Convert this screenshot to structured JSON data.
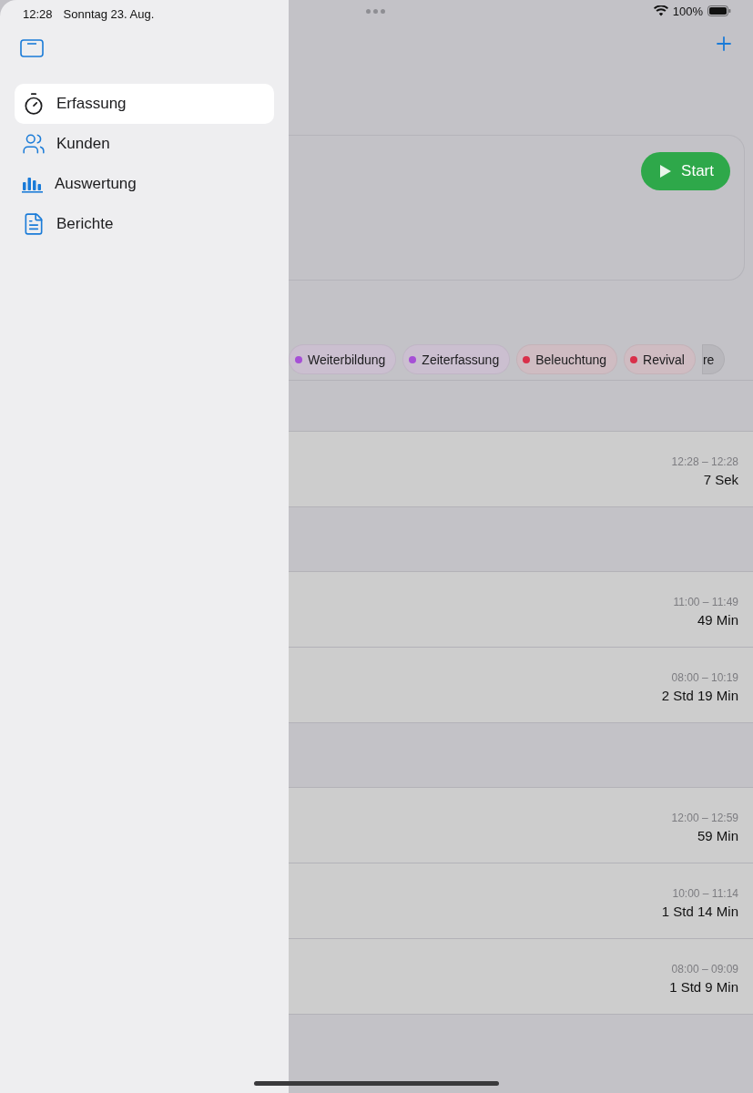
{
  "status_bar": {
    "time": "12:28",
    "date": "Sonntag 23. Aug.",
    "battery": "100%"
  },
  "sidebar": {
    "items": [
      {
        "label": "Erfassung",
        "selected": true
      },
      {
        "label": "Kunden",
        "selected": false
      },
      {
        "label": "Auswertung",
        "selected": false
      },
      {
        "label": "Berichte",
        "selected": false
      }
    ]
  },
  "main": {
    "start_button": "Start",
    "tags": [
      {
        "label": "Weiterbildung",
        "color": "#a64fd6"
      },
      {
        "label": "Zeiterfassung",
        "color": "#a64fd6"
      },
      {
        "label": "Beleuchtung",
        "color": "#d9304a"
      },
      {
        "label": "Revival",
        "color": "#d9304a"
      },
      {
        "label": "re"
      }
    ],
    "sections": [
      {
        "entries": [
          {
            "time_range": "12:28 – 12:28",
            "duration": "7 Sek"
          }
        ]
      },
      {
        "entries": [
          {
            "time_range": "11:00 – 11:49",
            "duration": "49 Min"
          },
          {
            "time_range": "08:00 – 10:19",
            "duration": "2 Std 19 Min"
          }
        ]
      },
      {
        "entries": [
          {
            "time_range": "12:00 – 12:59",
            "duration": "59 Min"
          },
          {
            "time_range": "10:00 – 11:14",
            "duration": "1 Std 14 Min"
          },
          {
            "time_range": "08:00 – 09:09",
            "duration": "1 Std 9 Min"
          }
        ]
      }
    ]
  }
}
